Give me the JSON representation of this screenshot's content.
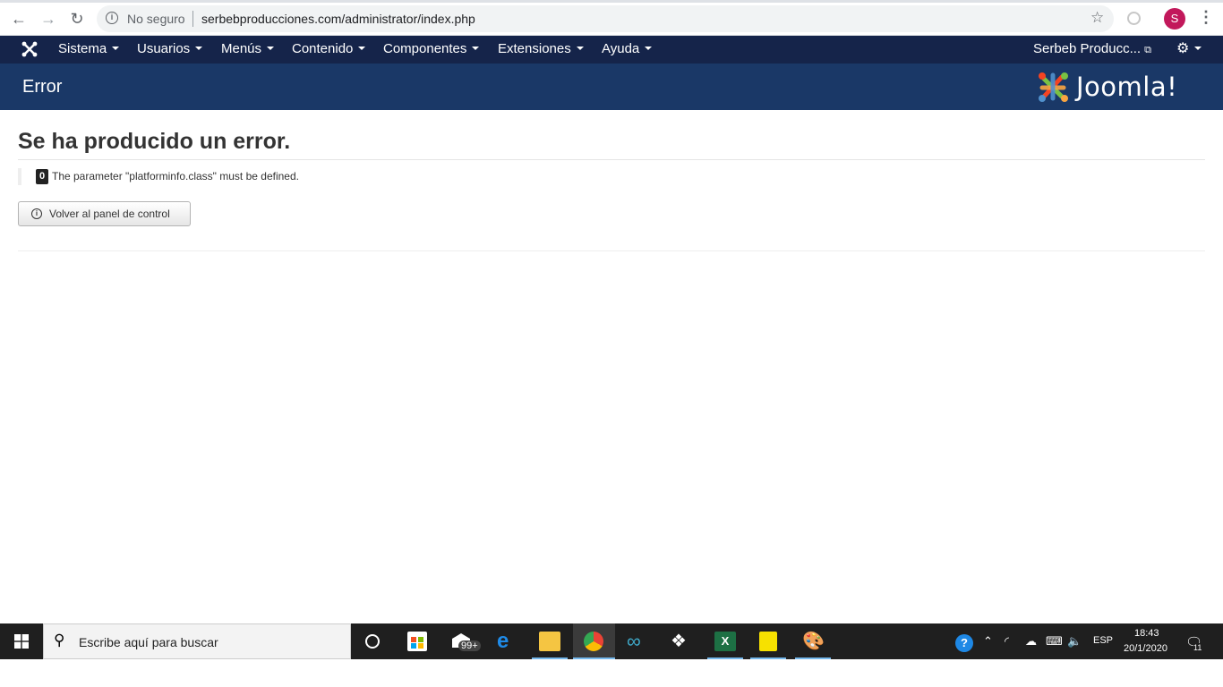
{
  "browser": {
    "insecure_label": "No seguro",
    "url": "serbebproducciones.com/administrator/index.php",
    "profile_initial": "S"
  },
  "navbar": {
    "menus": [
      "Sistema",
      "Usuarios",
      "Menús",
      "Contenido",
      "Componentes",
      "Extensiones",
      "Ayuda"
    ],
    "site_name": "Serbeb Producc..."
  },
  "header": {
    "title": "Error",
    "brand": "Joomla!"
  },
  "content": {
    "heading": "Se ha producido un error.",
    "error_code": "0",
    "error_message": "The parameter \"platforminfo.class\" must be defined.",
    "back_button": "Volver al panel de control"
  },
  "taskbar": {
    "search_placeholder": "Escribe aquí para buscar",
    "mail_badge": "99+",
    "language": "ESP",
    "time": "18:43",
    "date": "20/1/2020",
    "notification_count": "11"
  },
  "colors": {
    "navbar": "#15244a",
    "header": "#1a3867",
    "taskbar": "#1f1f1f",
    "profile": "#c2185b"
  }
}
